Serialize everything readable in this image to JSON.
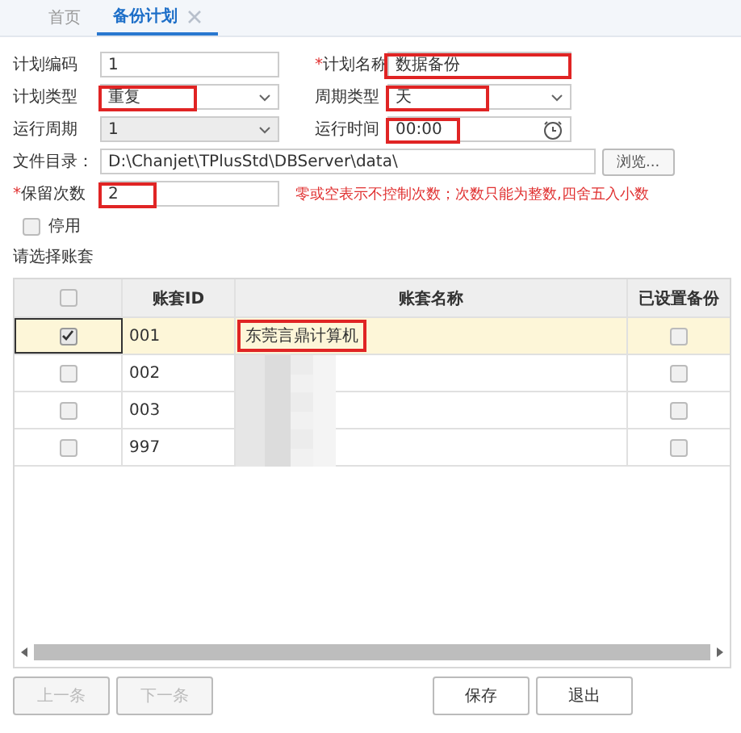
{
  "tabs": [
    {
      "label": "首页",
      "selected": false,
      "closable": false
    },
    {
      "label": "备份计划",
      "selected": true,
      "closable": true
    }
  ],
  "form": {
    "rows": [
      {
        "left": {
          "label": "计划编码",
          "kind": "text",
          "value": "1",
          "highlighted": false,
          "disabled": false
        },
        "right": {
          "required_mark": "*",
          "label": "计划名称",
          "kind": "text",
          "value": "数据备份",
          "highlighted": true,
          "disabled": false
        }
      },
      {
        "left": {
          "label": "计划类型",
          "kind": "select",
          "value": "重复",
          "highlighted": true,
          "disabled": false
        },
        "right": {
          "label": "周期类型",
          "kind": "select",
          "value": "天",
          "highlighted": true,
          "disabled": false
        }
      },
      {
        "left": {
          "label": "运行周期",
          "kind": "select",
          "value": "1",
          "highlighted": false,
          "disabled": true
        },
        "right": {
          "label": "运行时间",
          "kind": "time",
          "value": "00:00",
          "highlighted": true,
          "disabled": false
        }
      }
    ],
    "directory": {
      "label": "文件目录：",
      "value": "D:\\Chanjet\\TPlusStd\\DBServer\\data\\",
      "button": "浏览..."
    },
    "keep": {
      "required_mark": "*",
      "label": "保留次数",
      "value": "2",
      "highlighted": true,
      "hint": "零或空表示不控制次数；次数只能为整数,四舍五入小数"
    },
    "disable": {
      "label": "停用",
      "checked": false
    },
    "section_label": "请选择账套"
  },
  "table": {
    "columns": [
      "账套ID",
      "账套名称",
      "已设置备份"
    ],
    "all_checked": false,
    "rows": [
      {
        "checked": true,
        "selected": true,
        "id": "001",
        "name": "东莞言鼎计算机",
        "name_highlighted": true,
        "backup": false
      },
      {
        "checked": false,
        "selected": false,
        "id": "002",
        "name_redacted": true,
        "backup": false
      },
      {
        "checked": false,
        "selected": false,
        "id": "003",
        "name_redacted": true,
        "backup": false
      },
      {
        "checked": false,
        "selected": false,
        "id": "997",
        "name_redacted": true,
        "backup": false
      }
    ]
  },
  "buttons": [
    {
      "label": "上一条",
      "disabled": true
    },
    {
      "label": "下一条",
      "disabled": true
    },
    {
      "label": "保存",
      "disabled": false
    },
    {
      "label": "退出",
      "disabled": false
    }
  ]
}
